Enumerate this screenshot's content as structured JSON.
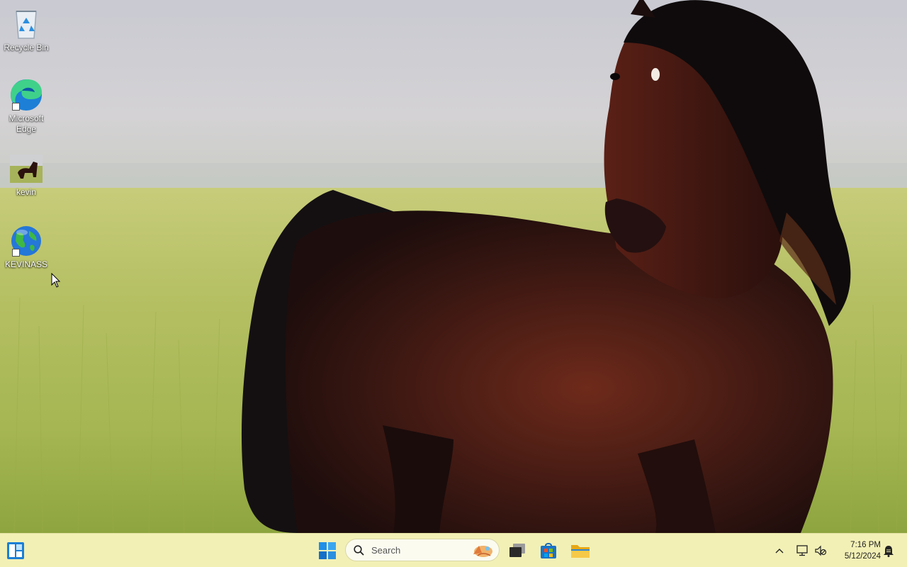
{
  "desktop": {
    "icons": [
      {
        "label": "Recycle Bin",
        "icon": "recycle-bin-icon"
      },
      {
        "label": "Microsoft Edge",
        "icon": "edge-icon"
      },
      {
        "label": "kevin",
        "icon": "image-file-icon"
      },
      {
        "label": "KEVINASS",
        "icon": "globe-icon"
      }
    ]
  },
  "taskbar": {
    "search": {
      "label": "Search"
    },
    "apps": [
      "start-icon",
      "widgets-icon",
      "task-view-icon",
      "store-icon",
      "file-explorer-icon"
    ],
    "tray": {
      "time": "7:16 PM",
      "date": "5/12/2024"
    }
  },
  "colors": {
    "taskbar": "#f2f0b5",
    "accent": "#0078d4"
  }
}
